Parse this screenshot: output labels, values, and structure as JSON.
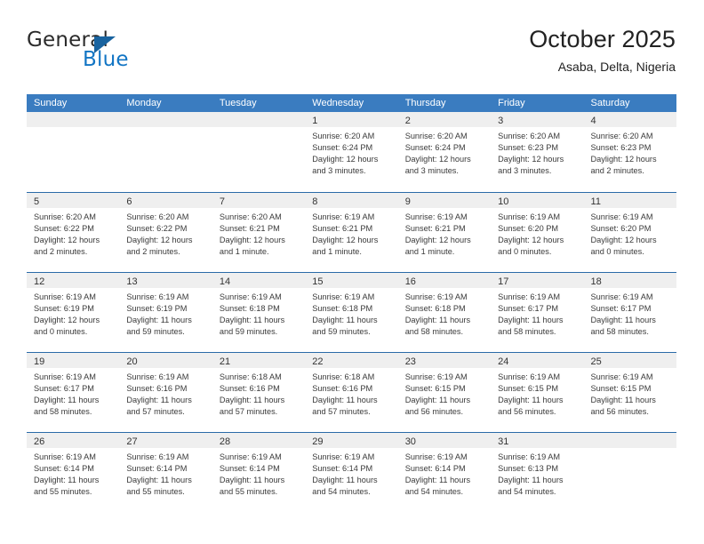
{
  "brand": {
    "name_top": "General",
    "name_bottom": "Blue",
    "triangle_icon": "triangle-icon",
    "accent_color": "#1275c4",
    "triangle_color": "#19639f"
  },
  "header": {
    "title": "October 2025",
    "subtitle": "Asaba, Delta, Nigeria"
  },
  "calendar": {
    "header_bg": "#3a7cc0",
    "divider_color": "#2a6ba8",
    "daynum_band_bg": "#efefef",
    "weekdays": [
      "Sunday",
      "Monday",
      "Tuesday",
      "Wednesday",
      "Thursday",
      "Friday",
      "Saturday"
    ],
    "weeks": [
      [
        {
          "day": "",
          "lines": []
        },
        {
          "day": "",
          "lines": []
        },
        {
          "day": "",
          "lines": []
        },
        {
          "day": "1",
          "lines": [
            "Sunrise: 6:20 AM",
            "Sunset: 6:24 PM",
            "Daylight: 12 hours",
            "and 3 minutes."
          ]
        },
        {
          "day": "2",
          "lines": [
            "Sunrise: 6:20 AM",
            "Sunset: 6:24 PM",
            "Daylight: 12 hours",
            "and 3 minutes."
          ]
        },
        {
          "day": "3",
          "lines": [
            "Sunrise: 6:20 AM",
            "Sunset: 6:23 PM",
            "Daylight: 12 hours",
            "and 3 minutes."
          ]
        },
        {
          "day": "4",
          "lines": [
            "Sunrise: 6:20 AM",
            "Sunset: 6:23 PM",
            "Daylight: 12 hours",
            "and 2 minutes."
          ]
        }
      ],
      [
        {
          "day": "5",
          "lines": [
            "Sunrise: 6:20 AM",
            "Sunset: 6:22 PM",
            "Daylight: 12 hours",
            "and 2 minutes."
          ]
        },
        {
          "day": "6",
          "lines": [
            "Sunrise: 6:20 AM",
            "Sunset: 6:22 PM",
            "Daylight: 12 hours",
            "and 2 minutes."
          ]
        },
        {
          "day": "7",
          "lines": [
            "Sunrise: 6:20 AM",
            "Sunset: 6:21 PM",
            "Daylight: 12 hours",
            "and 1 minute."
          ]
        },
        {
          "day": "8",
          "lines": [
            "Sunrise: 6:19 AM",
            "Sunset: 6:21 PM",
            "Daylight: 12 hours",
            "and 1 minute."
          ]
        },
        {
          "day": "9",
          "lines": [
            "Sunrise: 6:19 AM",
            "Sunset: 6:21 PM",
            "Daylight: 12 hours",
            "and 1 minute."
          ]
        },
        {
          "day": "10",
          "lines": [
            "Sunrise: 6:19 AM",
            "Sunset: 6:20 PM",
            "Daylight: 12 hours",
            "and 0 minutes."
          ]
        },
        {
          "day": "11",
          "lines": [
            "Sunrise: 6:19 AM",
            "Sunset: 6:20 PM",
            "Daylight: 12 hours",
            "and 0 minutes."
          ]
        }
      ],
      [
        {
          "day": "12",
          "lines": [
            "Sunrise: 6:19 AM",
            "Sunset: 6:19 PM",
            "Daylight: 12 hours",
            "and 0 minutes."
          ]
        },
        {
          "day": "13",
          "lines": [
            "Sunrise: 6:19 AM",
            "Sunset: 6:19 PM",
            "Daylight: 11 hours",
            "and 59 minutes."
          ]
        },
        {
          "day": "14",
          "lines": [
            "Sunrise: 6:19 AM",
            "Sunset: 6:18 PM",
            "Daylight: 11 hours",
            "and 59 minutes."
          ]
        },
        {
          "day": "15",
          "lines": [
            "Sunrise: 6:19 AM",
            "Sunset: 6:18 PM",
            "Daylight: 11 hours",
            "and 59 minutes."
          ]
        },
        {
          "day": "16",
          "lines": [
            "Sunrise: 6:19 AM",
            "Sunset: 6:18 PM",
            "Daylight: 11 hours",
            "and 58 minutes."
          ]
        },
        {
          "day": "17",
          "lines": [
            "Sunrise: 6:19 AM",
            "Sunset: 6:17 PM",
            "Daylight: 11 hours",
            "and 58 minutes."
          ]
        },
        {
          "day": "18",
          "lines": [
            "Sunrise: 6:19 AM",
            "Sunset: 6:17 PM",
            "Daylight: 11 hours",
            "and 58 minutes."
          ]
        }
      ],
      [
        {
          "day": "19",
          "lines": [
            "Sunrise: 6:19 AM",
            "Sunset: 6:17 PM",
            "Daylight: 11 hours",
            "and 58 minutes."
          ]
        },
        {
          "day": "20",
          "lines": [
            "Sunrise: 6:19 AM",
            "Sunset: 6:16 PM",
            "Daylight: 11 hours",
            "and 57 minutes."
          ]
        },
        {
          "day": "21",
          "lines": [
            "Sunrise: 6:18 AM",
            "Sunset: 6:16 PM",
            "Daylight: 11 hours",
            "and 57 minutes."
          ]
        },
        {
          "day": "22",
          "lines": [
            "Sunrise: 6:18 AM",
            "Sunset: 6:16 PM",
            "Daylight: 11 hours",
            "and 57 minutes."
          ]
        },
        {
          "day": "23",
          "lines": [
            "Sunrise: 6:19 AM",
            "Sunset: 6:15 PM",
            "Daylight: 11 hours",
            "and 56 minutes."
          ]
        },
        {
          "day": "24",
          "lines": [
            "Sunrise: 6:19 AM",
            "Sunset: 6:15 PM",
            "Daylight: 11 hours",
            "and 56 minutes."
          ]
        },
        {
          "day": "25",
          "lines": [
            "Sunrise: 6:19 AM",
            "Sunset: 6:15 PM",
            "Daylight: 11 hours",
            "and 56 minutes."
          ]
        }
      ],
      [
        {
          "day": "26",
          "lines": [
            "Sunrise: 6:19 AM",
            "Sunset: 6:14 PM",
            "Daylight: 11 hours",
            "and 55 minutes."
          ]
        },
        {
          "day": "27",
          "lines": [
            "Sunrise: 6:19 AM",
            "Sunset: 6:14 PM",
            "Daylight: 11 hours",
            "and 55 minutes."
          ]
        },
        {
          "day": "28",
          "lines": [
            "Sunrise: 6:19 AM",
            "Sunset: 6:14 PM",
            "Daylight: 11 hours",
            "and 55 minutes."
          ]
        },
        {
          "day": "29",
          "lines": [
            "Sunrise: 6:19 AM",
            "Sunset: 6:14 PM",
            "Daylight: 11 hours",
            "and 54 minutes."
          ]
        },
        {
          "day": "30",
          "lines": [
            "Sunrise: 6:19 AM",
            "Sunset: 6:14 PM",
            "Daylight: 11 hours",
            "and 54 minutes."
          ]
        },
        {
          "day": "31",
          "lines": [
            "Sunrise: 6:19 AM",
            "Sunset: 6:13 PM",
            "Daylight: 11 hours",
            "and 54 minutes."
          ]
        },
        {
          "day": "",
          "lines": []
        }
      ]
    ]
  }
}
